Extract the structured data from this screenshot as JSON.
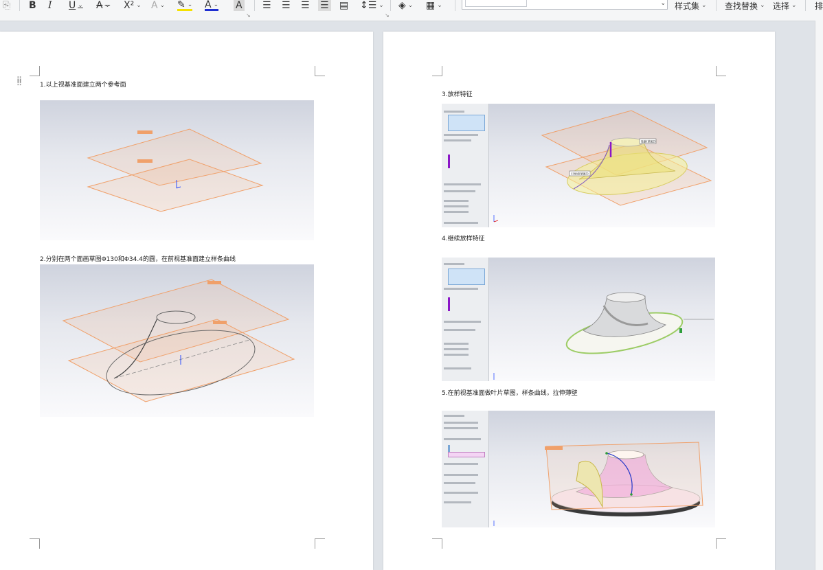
{
  "toolbar": {
    "bold": "B",
    "italic": "I",
    "underline": "U",
    "strikethrough": "A",
    "superscript": "X²",
    "text_effect": "A",
    "font_color": "A",
    "char_shading": "A",
    "styles_label": "样式集",
    "find_replace_label": "查找替换",
    "select_label": "选择",
    "arrange_label": "排",
    "colors": {
      "highlight": "#f5e100",
      "font_color": "#1f2fd1"
    }
  },
  "pages": {
    "left": {
      "captions": [
        "1.以上视基准面建立两个参考面",
        "2.分别在两个面画草图Φ130和Φ34.4的圆，在前视基准面建立样条曲线"
      ]
    },
    "right": {
      "captions": [
        "3.放样特征",
        "4.继续放样特征",
        "5.在前视基准面做叶片草图，样条曲线，拉伸薄壁"
      ]
    }
  },
  "figures": {
    "fig3_callout_1": "轮廓(草图2)",
    "fig3_callout_2": "引导线(草图3)"
  }
}
